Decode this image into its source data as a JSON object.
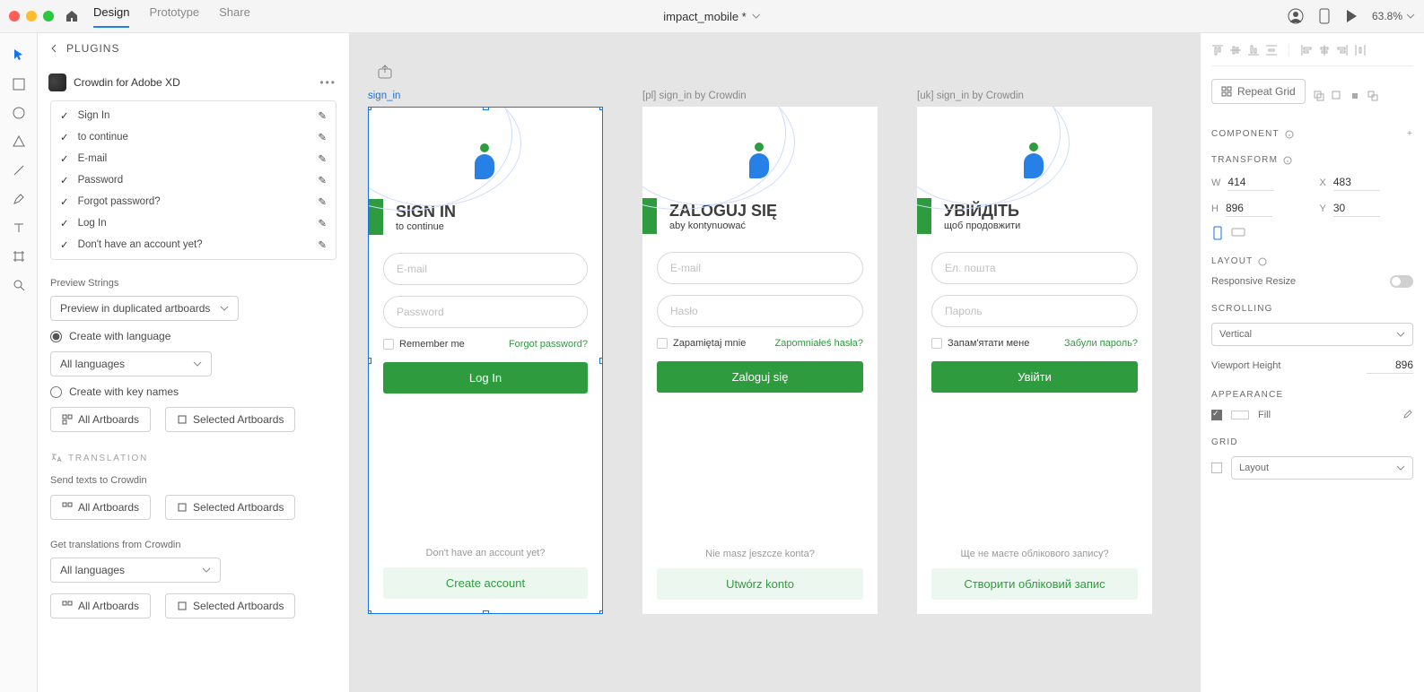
{
  "topbar": {
    "nav": {
      "design": "Design",
      "prototype": "Prototype",
      "share": "Share"
    },
    "doc_title": "impact_mobile *",
    "zoom": "63.8%"
  },
  "left_panel": {
    "header": "PLUGINS",
    "plugin_name": "Crowdin for Adobe XD",
    "strings": [
      "Sign In",
      "to continue",
      "E-mail",
      "Password",
      "Forgot password?",
      "Log In",
      "Don't have an account yet?"
    ],
    "preview_strings_label": "Preview Strings",
    "preview_select": "Preview in duplicated artboards",
    "radio_create_lang": "Create with language",
    "all_languages": "All languages",
    "radio_key_names": "Create with key names",
    "btn_all_artboards": "All Artboards",
    "btn_selected_artboards": "Selected Artboards",
    "translation_header": "TRANSLATION",
    "send_texts_label": "Send texts to Crowdin",
    "get_translations_label": "Get translations from Crowdin"
  },
  "artboards": [
    {
      "label": "sign_in",
      "selected": true,
      "title": "SIGN IN",
      "subtitle": "to continue",
      "email_placeholder": "E-mail",
      "password_placeholder": "Password",
      "remember": "Remember me",
      "forgot": "Forgot password?",
      "login_btn": "Log In",
      "no_account": "Don't have an account yet?",
      "create_account": "Create account"
    },
    {
      "label": "[pl] sign_in by Crowdin",
      "selected": false,
      "title": "ZALOGUJ SIĘ",
      "subtitle": "aby kontynuować",
      "email_placeholder": "E-mail",
      "password_placeholder": "Hasło",
      "remember": "Zapamiętaj mnie",
      "forgot": "Zapomniałeś hasła?",
      "login_btn": "Zaloguj się",
      "no_account": "Nie masz jeszcze konta?",
      "create_account": "Utwórz konto"
    },
    {
      "label": "[uk] sign_in by Crowdin",
      "selected": false,
      "title": "УВІЙДІТЬ",
      "subtitle": "щоб продовжити",
      "email_placeholder": "Ел. пошта",
      "password_placeholder": "Пароль",
      "remember": "Запам'ятати мене",
      "forgot": "Забули пароль?",
      "login_btn": "Увійти",
      "no_account": "Ще не маєте облікового запису?",
      "create_account": "Створити обліковий запис"
    }
  ],
  "right_panel": {
    "repeat_grid": "Repeat Grid",
    "component": "COMPONENT",
    "transform": "TRANSFORM",
    "w": "414",
    "h": "896",
    "x": "483",
    "y": "30",
    "layout": "LAYOUT",
    "responsive_resize": "Responsive Resize",
    "scrolling": "SCROLLING",
    "scrolling_value": "Vertical",
    "viewport_height_label": "Viewport Height",
    "viewport_height": "896",
    "appearance": "APPEARANCE",
    "fill": "Fill",
    "grid": "GRID",
    "grid_value": "Layout"
  }
}
